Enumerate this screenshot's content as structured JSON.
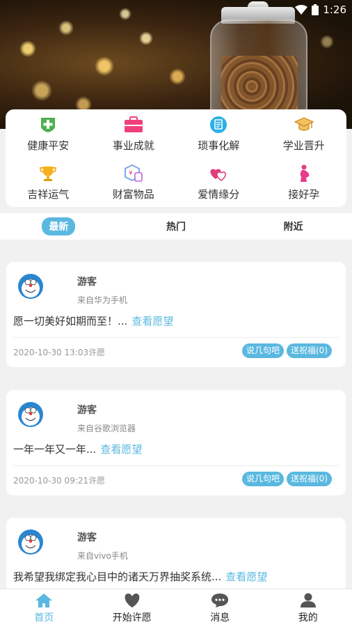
{
  "status": {
    "time": "1:26"
  },
  "categories": [
    {
      "label": "健康平安",
      "icon": "health-cross-icon",
      "color": "#4cb050"
    },
    {
      "label": "事业成就",
      "icon": "briefcase-icon",
      "color": "#f0407a"
    },
    {
      "label": "琐事化解",
      "icon": "notepad-icon",
      "color": "#2ab0e8"
    },
    {
      "label": "学业晋升",
      "icon": "graduation-cap-icon",
      "color": "#e8a030"
    },
    {
      "label": "吉祥运气",
      "icon": "trophy-icon",
      "color": "#f5b020"
    },
    {
      "label": "财富物品",
      "icon": "wealth-hexagon-icon",
      "color": "#8a6ee0"
    },
    {
      "label": "爱情缘分",
      "icon": "hearts-icon",
      "color": "#e0407a"
    },
    {
      "label": "接好孕",
      "icon": "pregnancy-icon",
      "color": "#e83a8a"
    }
  ],
  "tabs": [
    {
      "label": "最新",
      "active": true
    },
    {
      "label": "热门",
      "active": false
    },
    {
      "label": "附近",
      "active": false
    }
  ],
  "posts": [
    {
      "name": "游客",
      "source": "来自华为手机",
      "wish": "愿一切美好如期而至！...",
      "more": "查看愿望",
      "time": "2020-10-30 13:03许愿",
      "comment": "说几句吧",
      "bless": "送祝福(0)"
    },
    {
      "name": "游客",
      "source": "来自谷歌浏览器",
      "wish": "一年一年又一年...",
      "more": "查看愿望",
      "time": "2020-10-30 09:21许愿",
      "comment": "说几句吧",
      "bless": "送祝福(0)"
    },
    {
      "name": "游客",
      "source": "来自vivo手机",
      "wish": "我希望我绑定我心目中的诸天万界抽奖系统...",
      "more": "查看愿望",
      "time": "",
      "comment": "",
      "bless": ""
    }
  ],
  "nav": [
    {
      "label": "首页",
      "icon": "home-icon",
      "active": true
    },
    {
      "label": "开始许愿",
      "icon": "heart-icon",
      "active": false
    },
    {
      "label": "消息",
      "icon": "message-icon",
      "active": false
    },
    {
      "label": "我的",
      "icon": "user-icon",
      "active": false
    }
  ],
  "colors": {
    "accent": "#5ab8e0"
  }
}
